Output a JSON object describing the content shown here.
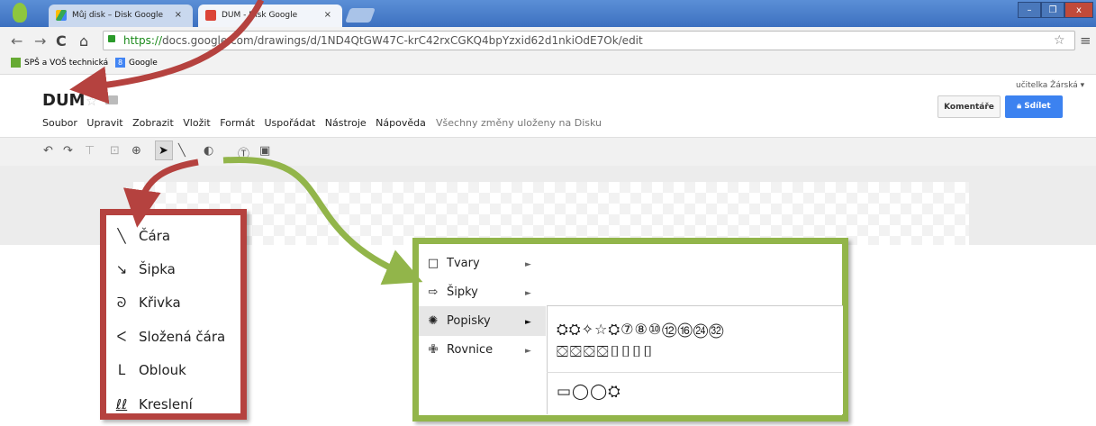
{
  "browser": {
    "tabs": [
      {
        "label": "Můj disk – Disk Google",
        "close": "×"
      },
      {
        "label": "DUM - Disk Google",
        "close": "×"
      }
    ],
    "window_buttons": [
      "–",
      "❐",
      "x"
    ],
    "url_https": "https://",
    "url_rest": "docs.google.com/drawings/d/1ND4QtGW47C-krC42rxCGKQ4bpYzxid62d1nkiOdE7Ok/edit",
    "bookmarks": [
      "SPŠ a VOŠ technická",
      "Google"
    ]
  },
  "doc": {
    "title": "DUM",
    "menu": [
      "Soubor",
      "Upravit",
      "Zobrazit",
      "Vložit",
      "Formát",
      "Uspořádat",
      "Nástroje",
      "Nápověda"
    ],
    "saved_status": "Všechny změny uloženy na Disku",
    "user": "učitelka Žárská ▾",
    "comments_label": "Komentáře",
    "share_label": "Sdílet"
  },
  "line_menu": {
    "items": [
      {
        "label": "Čára",
        "icon": "line-icon"
      },
      {
        "label": "Šipka",
        "icon": "arrow-icon"
      },
      {
        "label": "Křivka",
        "icon": "curve-icon"
      },
      {
        "label": "Složená čára",
        "icon": "polyline-icon"
      },
      {
        "label": "Oblouk",
        "icon": "arc-icon"
      },
      {
        "label": "Kreslení",
        "icon": "scribble-icon"
      }
    ]
  },
  "shape_menu": {
    "items": [
      {
        "label": "Tvary",
        "icon": "square-icon"
      },
      {
        "label": "Šipky",
        "icon": "arrow-outline-icon"
      },
      {
        "label": "Popisky",
        "icon": "callout-icon"
      },
      {
        "label": "Rovnice",
        "icon": "plus-outline-icon"
      }
    ],
    "callouts_row1": "⛭⛭✧☆⛭⑦⑧⑩⑫⑯㉔㉜",
    "callouts_row2": "⛋⛋⛋⛋⌷⌷⌷⌷",
    "callouts_row3": "▭◯◯⛭"
  },
  "colors": {
    "red_highlight": "#b5423f",
    "green_highlight": "#92b54a",
    "share_blue": "#3c82f0"
  }
}
